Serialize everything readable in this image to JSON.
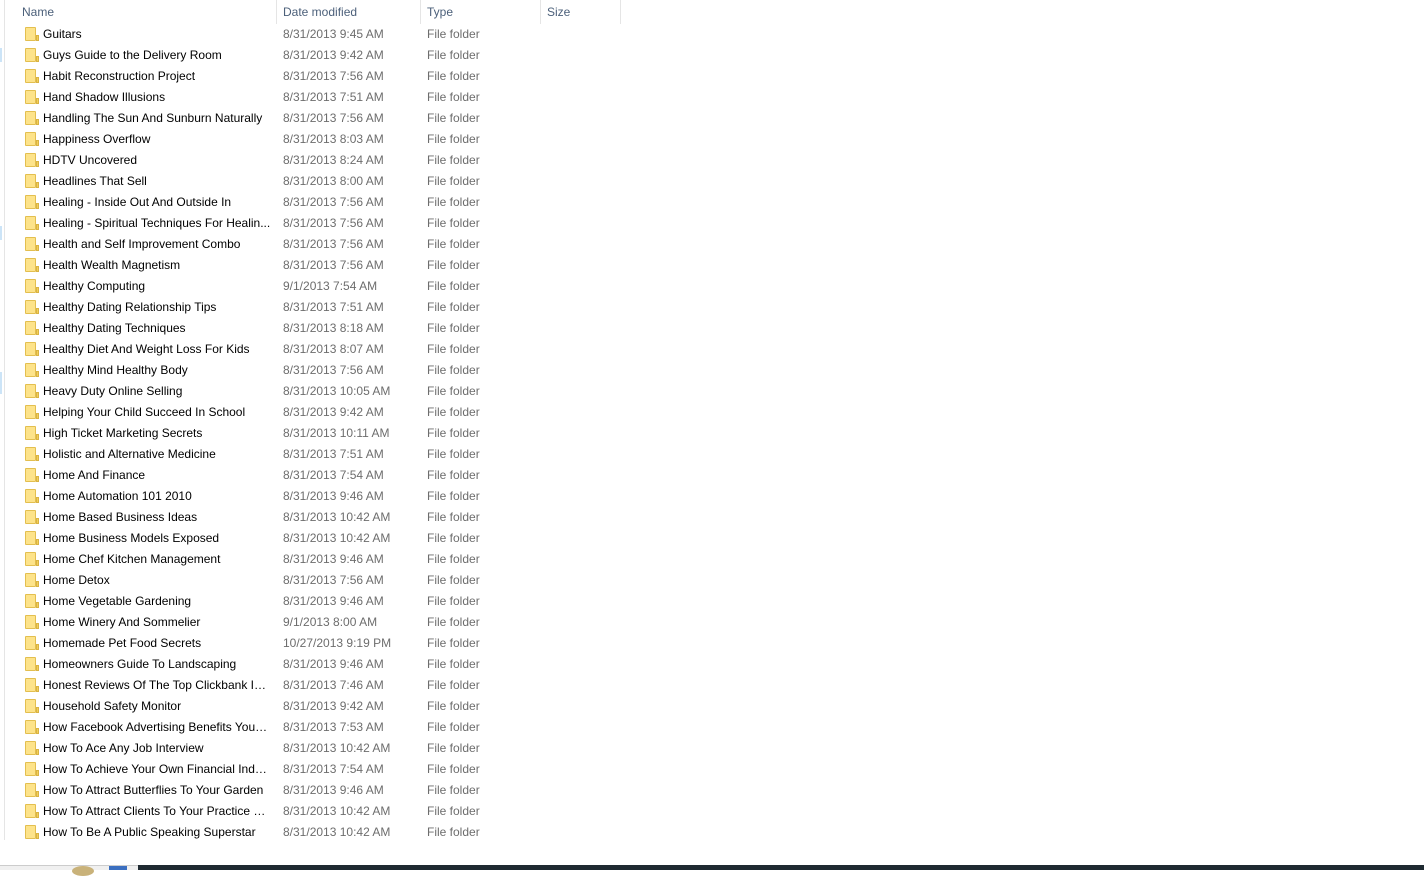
{
  "columns": {
    "name": "Name",
    "date_modified": "Date modified",
    "type": "Type",
    "size": "Size",
    "sort_indicator": "^"
  },
  "rows": [
    {
      "name": "Guitars",
      "date": "8/31/2013 9:45 AM",
      "type": "File folder",
      "size": ""
    },
    {
      "name": "Guys Guide to the Delivery Room",
      "date": "8/31/2013 9:42 AM",
      "type": "File folder",
      "size": ""
    },
    {
      "name": "Habit Reconstruction Project",
      "date": "8/31/2013 7:56 AM",
      "type": "File folder",
      "size": ""
    },
    {
      "name": "Hand Shadow Illusions",
      "date": "8/31/2013 7:51 AM",
      "type": "File folder",
      "size": ""
    },
    {
      "name": "Handling The Sun And Sunburn Naturally",
      "date": "8/31/2013 7:56 AM",
      "type": "File folder",
      "size": ""
    },
    {
      "name": "Happiness Overflow",
      "date": "8/31/2013 8:03 AM",
      "type": "File folder",
      "size": ""
    },
    {
      "name": "HDTV Uncovered",
      "date": "8/31/2013 8:24 AM",
      "type": "File folder",
      "size": ""
    },
    {
      "name": "Headlines That Sell",
      "date": "8/31/2013 8:00 AM",
      "type": "File folder",
      "size": ""
    },
    {
      "name": "Healing - Inside Out And Outside In",
      "date": "8/31/2013 7:56 AM",
      "type": "File folder",
      "size": ""
    },
    {
      "name": "Healing - Spiritual Techniques For Healin...",
      "date": "8/31/2013 7:56 AM",
      "type": "File folder",
      "size": ""
    },
    {
      "name": "Health and Self Improvement Combo",
      "date": "8/31/2013 7:56 AM",
      "type": "File folder",
      "size": ""
    },
    {
      "name": "Health Wealth Magnetism",
      "date": "8/31/2013 7:56 AM",
      "type": "File folder",
      "size": ""
    },
    {
      "name": "Healthy Computing",
      "date": "9/1/2013 7:54 AM",
      "type": "File folder",
      "size": ""
    },
    {
      "name": "Healthy Dating Relationship Tips",
      "date": "8/31/2013 7:51 AM",
      "type": "File folder",
      "size": ""
    },
    {
      "name": "Healthy Dating Techniques",
      "date": "8/31/2013 8:18 AM",
      "type": "File folder",
      "size": ""
    },
    {
      "name": "Healthy Diet And Weight Loss For Kids",
      "date": "8/31/2013 8:07 AM",
      "type": "File folder",
      "size": ""
    },
    {
      "name": "Healthy Mind Healthy Body",
      "date": "8/31/2013 7:56 AM",
      "type": "File folder",
      "size": ""
    },
    {
      "name": "Heavy Duty Online Selling",
      "date": "8/31/2013 10:05 AM",
      "type": "File folder",
      "size": ""
    },
    {
      "name": "Helping Your Child Succeed In School",
      "date": "8/31/2013 9:42 AM",
      "type": "File folder",
      "size": ""
    },
    {
      "name": "High Ticket Marketing Secrets",
      "date": "8/31/2013 10:11 AM",
      "type": "File folder",
      "size": ""
    },
    {
      "name": "Holistic and Alternative Medicine",
      "date": "8/31/2013 7:51 AM",
      "type": "File folder",
      "size": ""
    },
    {
      "name": "Home And Finance",
      "date": "8/31/2013 7:54 AM",
      "type": "File folder",
      "size": ""
    },
    {
      "name": "Home Automation 101 2010",
      "date": "8/31/2013 9:46 AM",
      "type": "File folder",
      "size": ""
    },
    {
      "name": "Home Based Business Ideas",
      "date": "8/31/2013 10:42 AM",
      "type": "File folder",
      "size": ""
    },
    {
      "name": "Home Business Models Exposed",
      "date": "8/31/2013 10:42 AM",
      "type": "File folder",
      "size": ""
    },
    {
      "name": "Home Chef Kitchen Management",
      "date": "8/31/2013 9:46 AM",
      "type": "File folder",
      "size": ""
    },
    {
      "name": "Home Detox",
      "date": "8/31/2013 7:56 AM",
      "type": "File folder",
      "size": ""
    },
    {
      "name": "Home Vegetable Gardening",
      "date": "8/31/2013 9:46 AM",
      "type": "File folder",
      "size": ""
    },
    {
      "name": "Home Winery And Sommelier",
      "date": "9/1/2013 8:00 AM",
      "type": "File folder",
      "size": ""
    },
    {
      "name": "Homemade Pet Food Secrets",
      "date": "10/27/2013 9:19 PM",
      "type": "File folder",
      "size": ""
    },
    {
      "name": "Homeowners Guide To Landscaping",
      "date": "8/31/2013 9:46 AM",
      "type": "File folder",
      "size": ""
    },
    {
      "name": "Honest Reviews Of The Top Clickbank IM...",
      "date": "8/31/2013 7:46 AM",
      "type": "File folder",
      "size": ""
    },
    {
      "name": "Household Safety Monitor",
      "date": "8/31/2013 9:42 AM",
      "type": "File folder",
      "size": ""
    },
    {
      "name": "How Facebook Advertising Benefits Your ...",
      "date": "8/31/2013 7:53 AM",
      "type": "File folder",
      "size": ""
    },
    {
      "name": "How To Ace Any Job Interview",
      "date": "8/31/2013 10:42 AM",
      "type": "File folder",
      "size": ""
    },
    {
      "name": "How To Achieve Your Own Financial Inde...",
      "date": "8/31/2013 7:54 AM",
      "type": "File folder",
      "size": ""
    },
    {
      "name": "How To Attract Butterflies To Your Garden",
      "date": "8/31/2013 9:46 AM",
      "type": "File folder",
      "size": ""
    },
    {
      "name": "How To Attract Clients To Your Practice E...",
      "date": "8/31/2013 10:42 AM",
      "type": "File folder",
      "size": ""
    },
    {
      "name": "How To Be A Public Speaking Superstar",
      "date": "8/31/2013 10:42 AM",
      "type": "File folder",
      "size": ""
    }
  ],
  "icons": {
    "row_icon": "folder-icon",
    "sort": "sort-ascending-icon"
  },
  "colors": {
    "header_text": "#4c607a",
    "detail_text": "#6d6d6d",
    "folder_fill": "#fde38a",
    "taskbar": "#1f2a31"
  }
}
